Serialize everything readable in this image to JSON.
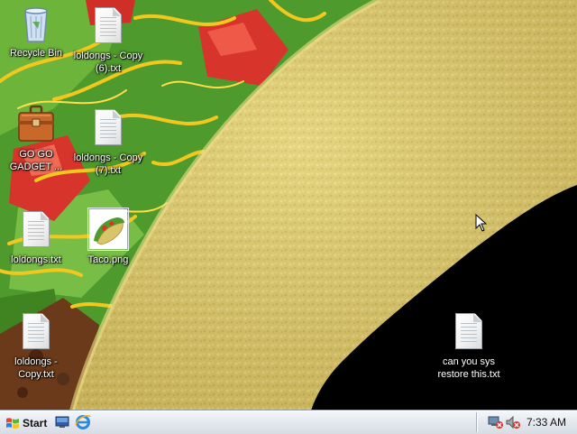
{
  "desktop": {
    "icons": [
      {
        "label": "Recycle Bin"
      },
      {
        "label": "loldongs - Copy (6).txt"
      },
      {
        "label": "GO GO GADGET ..."
      },
      {
        "label": "loldongs - Copy (7).txt"
      },
      {
        "label": "loldongs.txt"
      },
      {
        "label": "Taco.png"
      },
      {
        "label": "loldongs - Copy.txt"
      },
      {
        "label": "can you sys restore this.txt"
      }
    ]
  },
  "taskbar": {
    "start_label": "Start",
    "clock": "7:33 AM",
    "quick_launch": [
      "show-desktop-icon",
      "internet-explorer-icon"
    ],
    "tray_icons": [
      "network-disconnected-icon",
      "volume-muted-icon"
    ]
  },
  "colors": {
    "taskbar": "#e4e8ee",
    "taco_shell": "#d9c86a",
    "lettuce": "#4f9a2c",
    "tomato": "#d7342b",
    "cheese": "#f2c81f"
  }
}
